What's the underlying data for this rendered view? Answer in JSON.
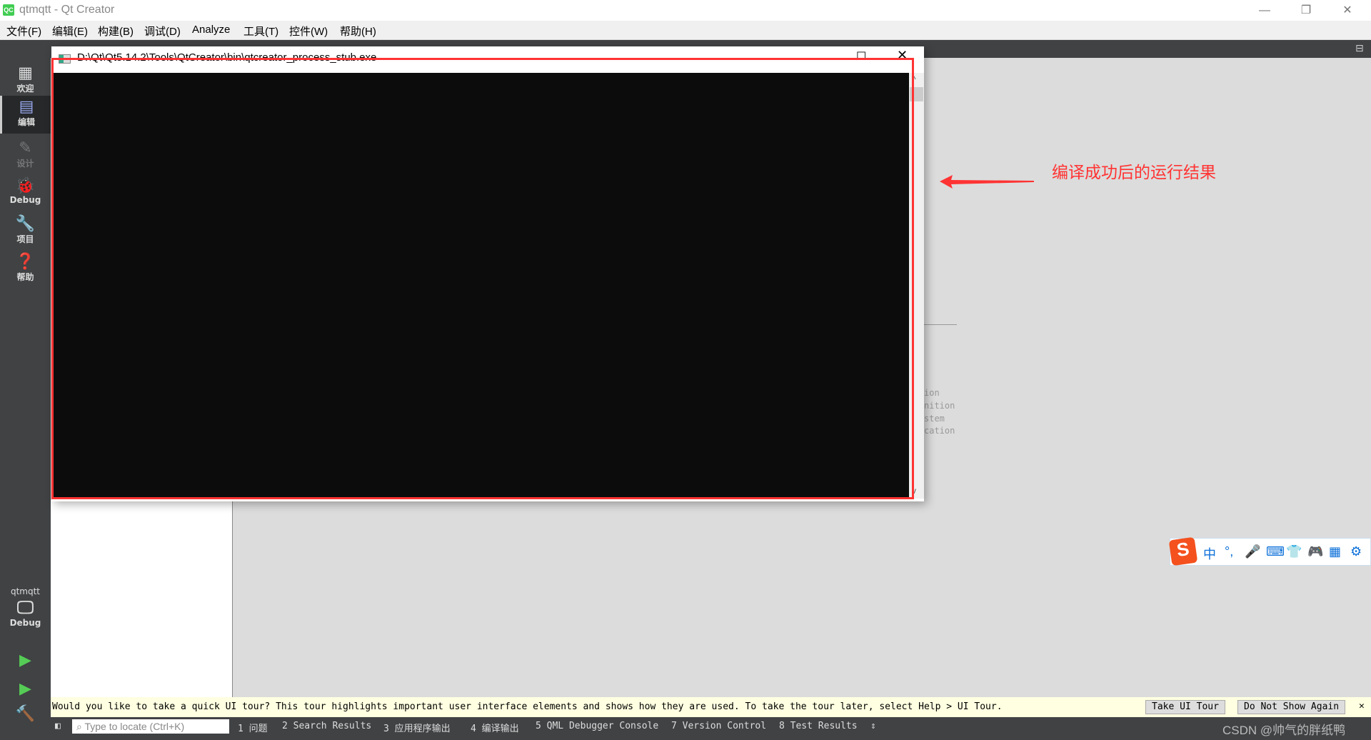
{
  "window": {
    "title": "qtmqtt - Qt Creator",
    "app_icon": "QC"
  },
  "menu": [
    "文件(F)",
    "编辑(E)",
    "构建(B)",
    "调试(D)",
    "Analyze",
    "工具(T)",
    "控件(W)",
    "帮助(H)"
  ],
  "sidebar": {
    "items": [
      {
        "label": "欢迎",
        "icon": "grid-icon"
      },
      {
        "label": "编辑",
        "icon": "edit-document-icon",
        "selected": true
      },
      {
        "label": "设计",
        "icon": "pencil-icon",
        "disabled": true
      },
      {
        "label": "Debug",
        "icon": "bug-icon"
      },
      {
        "label": "项目",
        "icon": "wrench-icon"
      },
      {
        "label": "帮助",
        "icon": "help-icon"
      }
    ],
    "kit": {
      "project": "qtmqtt",
      "mode": "Debug"
    }
  },
  "console": {
    "title": "D:\\Qt\\Qt5.14.2\\Tools\\QtCreator\\bin\\qtcreator_process_stub.exe"
  },
  "annotation": {
    "text": "编译成功后的运行结果",
    "color": "#ff3333"
  },
  "background_fragments": [
    "ion",
    "nition",
    "stem",
    "cation"
  ],
  "tour": {
    "message": "Would you like to take a quick UI tour? This tour highlights important user interface elements and shows how they are used. To take the tour later, select Help > UI Tour.",
    "take_label": "Take UI Tour",
    "dismiss_label": "Do Not Show Again",
    "close": "✕"
  },
  "statusbar": {
    "locate_placeholder": "Type to locate (Ctrl+K)",
    "panes": [
      "1 问题",
      "2 Search Results",
      "3 应用程序输出",
      "4 编译输出",
      "5 QML Debugger Console",
      "7 Version Control",
      "8 Test Results"
    ],
    "watermark": "CSDN @帅气的胖纸鸭"
  },
  "ime": {
    "items": [
      "中",
      "°,",
      "🎤",
      "⌨",
      "👕",
      "🎮",
      "▦",
      "⚙"
    ]
  }
}
